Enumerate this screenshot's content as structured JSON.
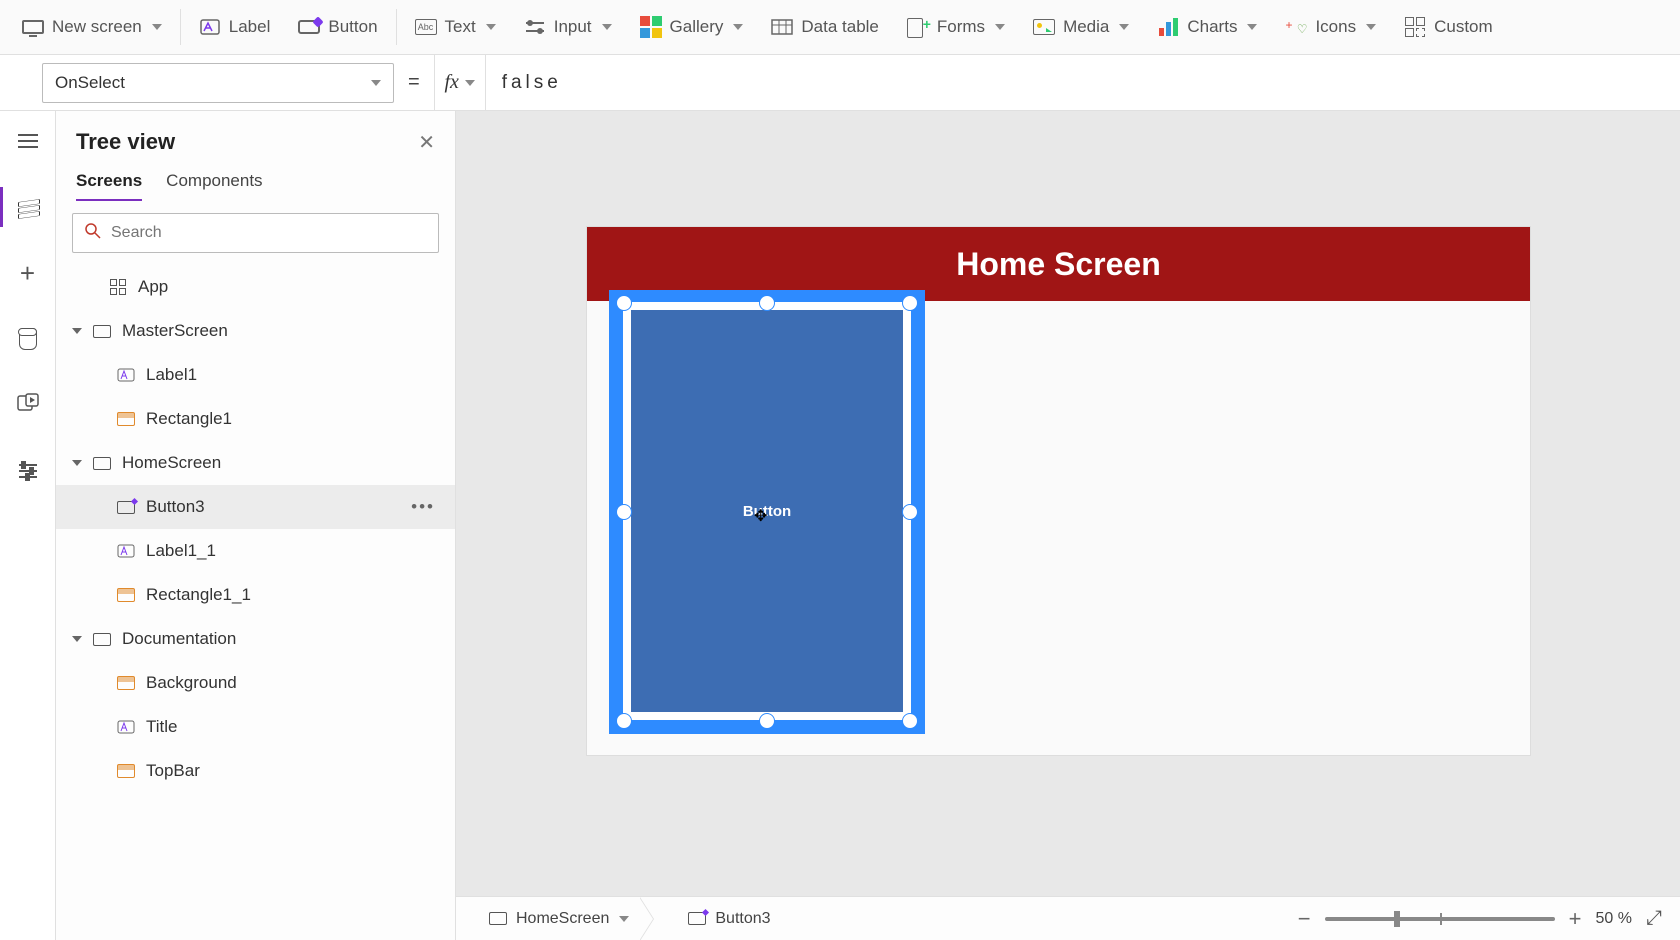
{
  "toolbar": {
    "new_screen": "New screen",
    "label": "Label",
    "button": "Button",
    "text": "Text",
    "input": "Input",
    "gallery": "Gallery",
    "data_table": "Data table",
    "forms": "Forms",
    "media": "Media",
    "charts": "Charts",
    "icons": "Icons",
    "custom": "Custom"
  },
  "formula": {
    "property": "OnSelect",
    "value": "false"
  },
  "tree": {
    "title": "Tree view",
    "tabs": {
      "screens": "Screens",
      "components": "Components"
    },
    "search_placeholder": "Search",
    "items": [
      {
        "label": "App",
        "type": "app",
        "level": 1
      },
      {
        "label": "MasterScreen",
        "type": "screen",
        "level": 1,
        "expandable": true
      },
      {
        "label": "Label1",
        "type": "label",
        "level": 2
      },
      {
        "label": "Rectangle1",
        "type": "rect",
        "level": 2
      },
      {
        "label": "HomeScreen",
        "type": "screen",
        "level": 1,
        "expandable": true
      },
      {
        "label": "Button3",
        "type": "button",
        "level": 2,
        "selected": true
      },
      {
        "label": "Label1_1",
        "type": "label",
        "level": 2
      },
      {
        "label": "Rectangle1_1",
        "type": "rect",
        "level": 2
      },
      {
        "label": "Documentation",
        "type": "screen",
        "level": 1,
        "expandable": true
      },
      {
        "label": "Background",
        "type": "rect",
        "level": 2
      },
      {
        "label": "Title",
        "type": "label",
        "level": 2
      },
      {
        "label": "TopBar",
        "type": "rect",
        "level": 2
      }
    ]
  },
  "canvas": {
    "header_title": "Home Screen",
    "button_text": "Button"
  },
  "breadcrumb": {
    "screen": "HomeScreen",
    "control": "Button3"
  },
  "zoom": {
    "value": "50",
    "unit": "%"
  }
}
